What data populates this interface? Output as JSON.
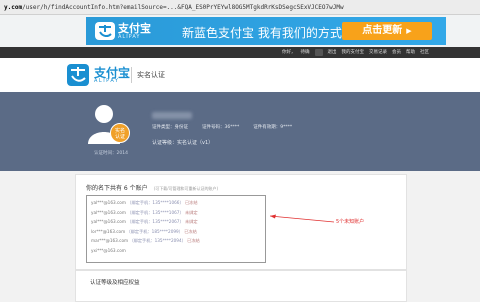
{
  "address_bar": {
    "url_prefix": "y.com",
    "url_rest": "/user/h/findAccountInfo.htm?emailSource=...&FQA_ES0PrYEYwl8OG5MTgkdRrKsDSegcSExVJCEO7wJMw"
  },
  "banner": {
    "logo_text": "支付宝",
    "logo_sub": "ALIPAY",
    "slogan": "新蓝色支付宝  我有我们的方式",
    "cta_label": "点击更新",
    "cta_arrow": "▶"
  },
  "top_nav": {
    "items": [
      "你好，",
      "待确",
      "",
      "退出",
      "我的支付宝",
      "交易记录",
      "会员",
      "帮助",
      "社区"
    ]
  },
  "header": {
    "logo_text": "支付宝",
    "logo_sub": "ALIPAY",
    "title": "实名认证"
  },
  "profile": {
    "badge_line1": "实名",
    "badge_line2": "认证",
    "since": "认证时间：2014",
    "stats": [
      "证件类型：身份证",
      "证件号码：36****",
      "证件有效期：9****"
    ],
    "cert_level": "认证等级：实名认证（v1）"
  },
  "accounts_card": {
    "title": "你的名下共有 6 个账户",
    "note": "(可下载/可管理和可重新认证的账户)",
    "annotation": "5个未知账户",
    "rows": [
      {
        "email": "yal***@163.com",
        "phone": "（绑定手机：135****1066）",
        "status": "已冻结"
      },
      {
        "email": "yal***@163.com",
        "phone": "（绑定手机：135****1067）",
        "status": "未绑定"
      },
      {
        "email": "yal***@163.com",
        "phone": "（绑定手机：135****2067）",
        "status": "未绑定"
      },
      {
        "email": "lor***@163.com",
        "phone": "（绑定手机：185****2099）",
        "status": "已冻结"
      },
      {
        "email": "mar***@163.com",
        "phone": "（绑定手机：135****2094）",
        "status": "已冻结"
      },
      {
        "email": "yxi***@163.com",
        "phone": "",
        "status": ""
      }
    ]
  },
  "benefits_card": {
    "title": "认证等级及相应权益"
  },
  "colors": {
    "banner_blue": "#2a9ad8",
    "cta_orange": "#f8a21a",
    "profile_bg": "#5b6b86",
    "badge_orange": "#f0a029",
    "annotation_red": "#e03030"
  }
}
